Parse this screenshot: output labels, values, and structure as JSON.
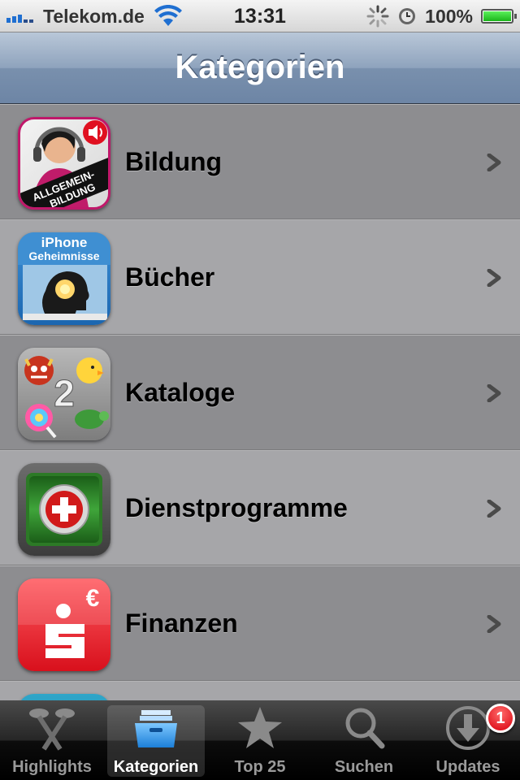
{
  "status_bar": {
    "carrier": "Telekom.de",
    "time": "13:31",
    "battery_percent": "100%"
  },
  "nav": {
    "title": "Kategorien"
  },
  "categories": [
    {
      "label": "Bildung",
      "icon": "allgemeinbildung-app-icon",
      "icon_text": [
        "ALLGEMEIN-",
        "BILDUNG"
      ]
    },
    {
      "label": "Bücher",
      "icon": "iphone-geheimnisse-app-icon",
      "icon_text": [
        "iPhone",
        "Geheimnisse"
      ]
    },
    {
      "label": "Kataloge",
      "icon": "emoji-2-app-icon",
      "icon_text": [
        "2"
      ]
    },
    {
      "label": "Dienstprogramme",
      "icon": "battery-doctor-app-icon",
      "icon_text": []
    },
    {
      "label": "Finanzen",
      "icon": "sparkasse-app-icon",
      "icon_text": [
        "€"
      ]
    }
  ],
  "tabs": [
    {
      "label": "Highlights",
      "icon": "highlights-icon",
      "active": false
    },
    {
      "label": "Kategorien",
      "icon": "kategorien-icon",
      "active": true
    },
    {
      "label": "Top 25",
      "icon": "star-icon",
      "active": false
    },
    {
      "label": "Suchen",
      "icon": "search-icon",
      "active": false
    },
    {
      "label": "Updates",
      "icon": "download-icon",
      "active": false,
      "badge": "1"
    }
  ],
  "colors": {
    "nav_gradient_top": "#b9c7d8",
    "nav_gradient_bottom": "#6d85a5",
    "row_dark": "#8d8d90",
    "row_light": "#a6a6a9",
    "badge_red": "#d8000c",
    "tab_active_blue": "#3a9ae8"
  }
}
